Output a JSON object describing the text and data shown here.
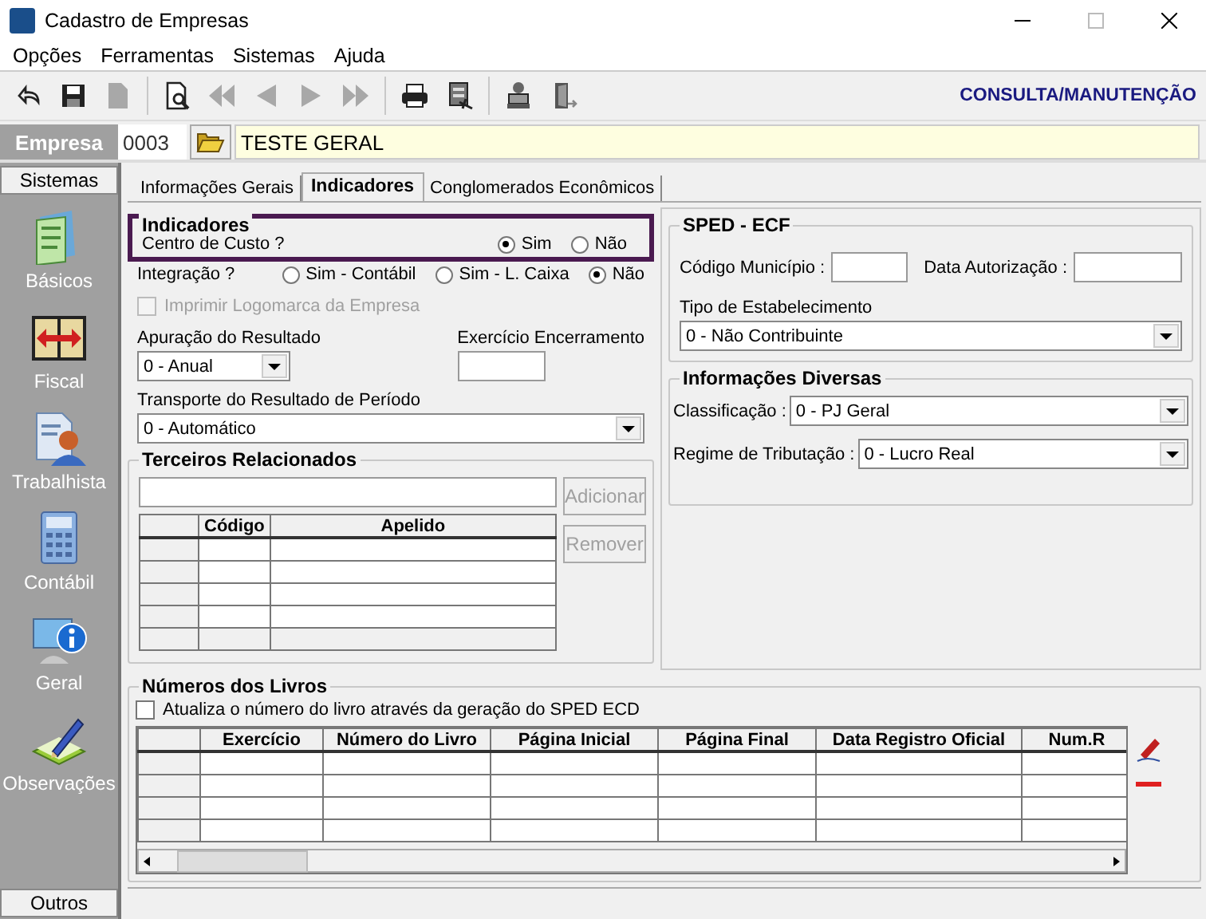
{
  "window": {
    "title": "Cadastro de Empresas"
  },
  "menu": [
    "Opções",
    "Ferramentas",
    "Sistemas",
    "Ajuda"
  ],
  "toolbar": {
    "buttons": [
      {
        "kind": "undo",
        "disabled": false
      },
      {
        "kind": "save",
        "disabled": false
      },
      {
        "kind": "document",
        "disabled": true
      },
      {
        "kind": "sep"
      },
      {
        "kind": "preview",
        "disabled": false
      },
      {
        "kind": "first",
        "disabled": true
      },
      {
        "kind": "prev",
        "disabled": true
      },
      {
        "kind": "next",
        "disabled": true
      },
      {
        "kind": "last",
        "disabled": true
      },
      {
        "kind": "sep"
      },
      {
        "kind": "print",
        "disabled": false
      },
      {
        "kind": "report",
        "disabled": false
      },
      {
        "kind": "sep"
      },
      {
        "kind": "stamp",
        "disabled": false
      },
      {
        "kind": "exit",
        "disabled": false
      }
    ],
    "mode": "CONSULTA/MANUTENÇÃO"
  },
  "empresa": {
    "label": "Empresa",
    "code": "0003",
    "name": "TESTE GERAL"
  },
  "sidebar": {
    "header": "Sistemas",
    "items": [
      {
        "label": "Básicos",
        "kind": "basicos"
      },
      {
        "label": "Fiscal",
        "kind": "fiscal"
      },
      {
        "label": "Trabalhista",
        "kind": "trabalhista"
      },
      {
        "label": "Contábil",
        "kind": "contabil"
      },
      {
        "label": "Geral",
        "kind": "geral"
      },
      {
        "label": "Observações",
        "kind": "observacoes"
      }
    ],
    "footer": "Outros"
  },
  "tabs": [
    {
      "label": "Informações Gerais",
      "selected": false
    },
    {
      "label": "Indicadores",
      "selected": true
    },
    {
      "label": "Conglomerados Econômicos",
      "selected": false
    }
  ],
  "indicadores": {
    "title": "Indicadores",
    "highlighted": true,
    "label": "Centro de Custo ?",
    "options": [
      {
        "label": "Sim",
        "selected": true
      },
      {
        "label": "Não",
        "selected": false
      }
    ]
  },
  "integracao": {
    "label": "Integração ?",
    "options": [
      {
        "label": "Sim - Contábil",
        "selected": false
      },
      {
        "label": "Sim - L. Caixa",
        "selected": false
      },
      {
        "label": "Não",
        "selected": true
      }
    ]
  },
  "imprimir_logomarca": {
    "label": "Imprimir Logomarca da Empresa",
    "checked": false,
    "disabled": true
  },
  "apuracao": {
    "label": "Apuração do Resultado",
    "value": "0 - Anual"
  },
  "exercicio_encerramento": {
    "label": "Exercício Encerramento"
  },
  "transporte": {
    "label": "Transporte do Resultado de Período",
    "value": "0 - Automático"
  },
  "terceiros": {
    "title": "Terceiros Relacionados",
    "columns": [
      "Código",
      "Apelido"
    ],
    "buttons": [
      {
        "label": "Adicionar",
        "disabled": true
      },
      {
        "label": "Remover",
        "disabled": true
      }
    ]
  },
  "sped_ecf": {
    "title": "SPED - ECF",
    "codigo_municipio": "Código Município :",
    "data_autorizacao": "Data Autorização :",
    "tipo_label": "Tipo de Estabelecimento",
    "tipo_value": "0 - Não Contribuinte"
  },
  "informacoes_diversas": {
    "title": "Informações Diversas",
    "fields": [
      {
        "label": "Classificação :",
        "value": "0 - PJ Geral"
      },
      {
        "label": "Regime de Tributação :",
        "value": "0 - Lucro Real"
      }
    ]
  },
  "numeros_livros": {
    "title": "Números dos Livros",
    "checkbox": {
      "label": "Atualiza o número do livro através da geração do SPED ECD",
      "checked": false
    },
    "columns": [
      "Exercício",
      "Número do Livro",
      "Página Inicial",
      "Página Final",
      "Data Registro Oficial",
      "Num.R"
    ]
  }
}
